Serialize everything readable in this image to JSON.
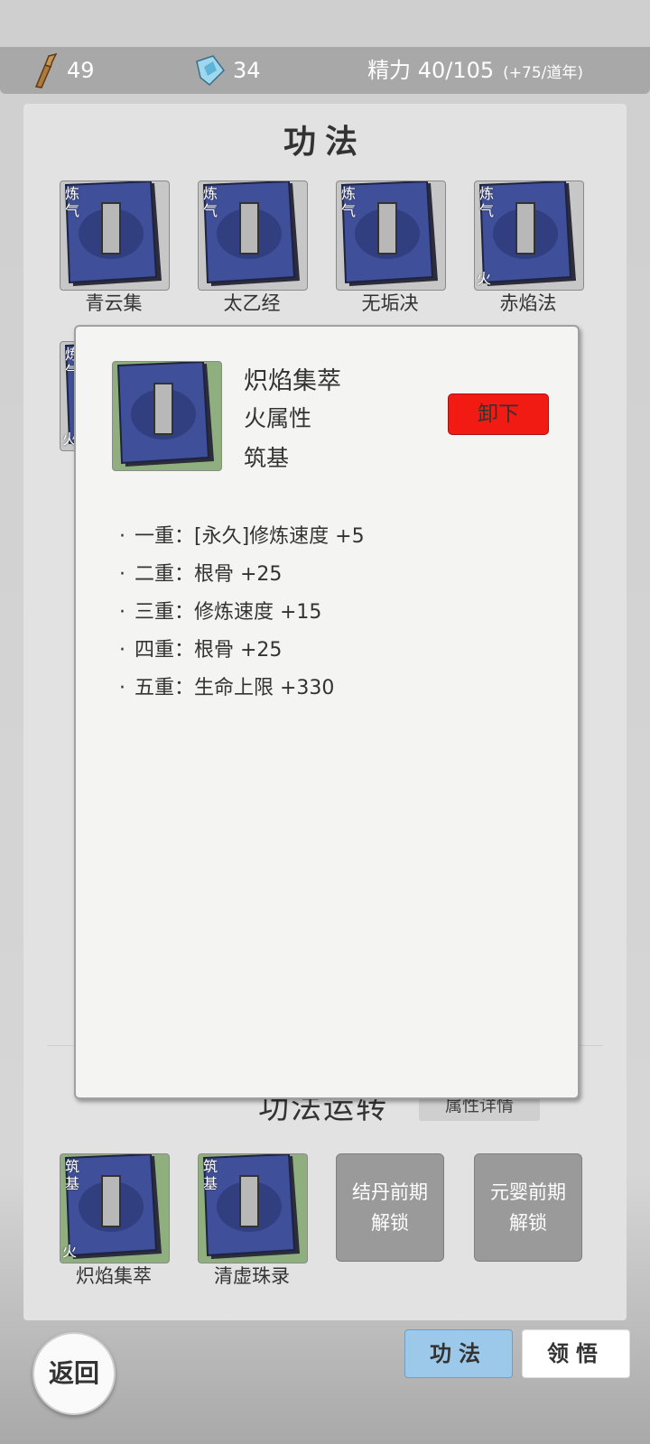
{
  "topbar": {
    "brush_count": "49",
    "crystal_count": "34",
    "energy": "精力 40/105",
    "energy_rate": "(+75/道年)"
  },
  "panel": {
    "title": "功法"
  },
  "books_top": [
    {
      "name": "青云集",
      "realm": "炼气",
      "element": ""
    },
    {
      "name": "太乙经",
      "realm": "炼气",
      "element": ""
    },
    {
      "name": "无垢决",
      "realm": "炼气",
      "element": ""
    },
    {
      "name": "赤焰法",
      "realm": "炼气",
      "element": "火"
    }
  ],
  "book_row2": {
    "realm": "炼气",
    "element": "火"
  },
  "modal": {
    "name": "炽焰集萃",
    "attribute": "火属性",
    "rank": "筑基",
    "unequip_label": "卸下",
    "effects": [
      "一重：[永久]修炼速度 +5",
      "二重：根骨 +25",
      "三重：修炼速度 +15",
      "四重：根骨 +25",
      "五重：生命上限 +330"
    ]
  },
  "running": {
    "title": "功法运转",
    "detail_label": "属性详情",
    "slots": [
      {
        "name": "炽焰集萃",
        "realm": "筑基",
        "element": "火"
      },
      {
        "name": "清虚珠录",
        "realm": "筑基",
        "element": ""
      }
    ],
    "locked": [
      {
        "line1": "结丹前期",
        "line2": "解锁"
      },
      {
        "line1": "元婴前期",
        "line2": "解锁"
      }
    ]
  },
  "nav": {
    "back_label": "返回",
    "tab_active": "功法",
    "tab_other": "领悟"
  },
  "colors": {
    "unequip_red": "#f21b14",
    "active_tab": "#9cc8ea",
    "book_blue": "#3f4f9a"
  }
}
